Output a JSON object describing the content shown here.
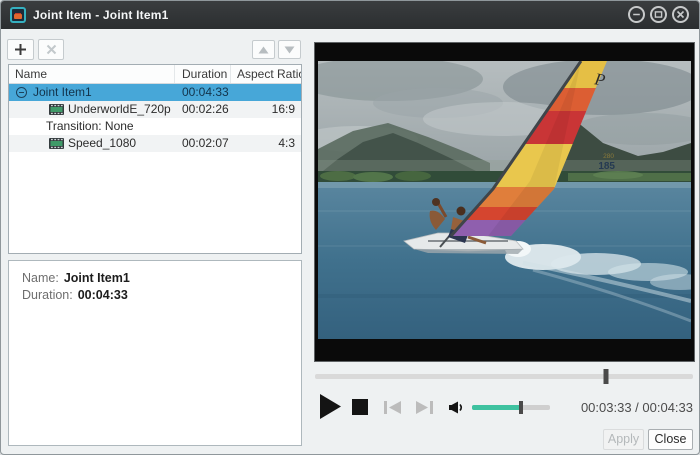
{
  "window": {
    "title": "Joint Item - Joint Item1"
  },
  "list": {
    "columns": [
      "Name",
      "Duration",
      "Aspect Ratio"
    ],
    "rows": [
      {
        "name": "Joint Item1",
        "duration": "00:04:33",
        "aspect_ratio": ""
      },
      {
        "name": "UnderworldE_720p",
        "duration": "00:02:26",
        "aspect_ratio": "16:9"
      },
      {
        "name": "Transition: None",
        "duration": "",
        "aspect_ratio": ""
      },
      {
        "name": "Speed_1080",
        "duration": "00:02:07",
        "aspect_ratio": "4:3"
      }
    ]
  },
  "details": {
    "name_label": "Name:",
    "name_value": "Joint Item1",
    "duration_label": "Duration:",
    "duration_value": "00:04:33"
  },
  "player": {
    "time_display": "00:03:33 / 00:04:33",
    "seek_progress_pct": 77,
    "volume_pct": 63,
    "accent_color": "#3ec2a0"
  },
  "video_overlay": {
    "sail_logo": "P",
    "sail_number_top": "280",
    "sail_number": "185"
  },
  "actions": {
    "apply": "Apply",
    "close": "Close"
  }
}
